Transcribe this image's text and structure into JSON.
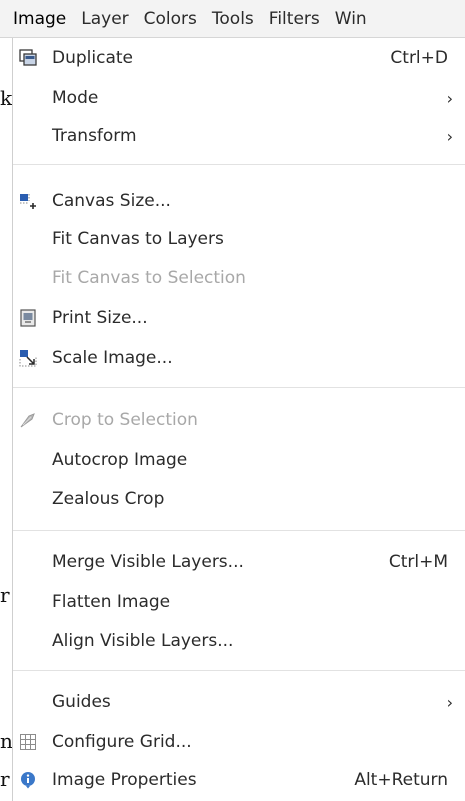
{
  "background": {
    "snippets": [
      "k",
      "r",
      "n",
      "r"
    ]
  },
  "menubar": {
    "items": [
      "Image",
      "Layer",
      "Colors",
      "Tools",
      "Filters",
      "Win"
    ]
  },
  "menu": {
    "duplicate": {
      "label": "Duplicate",
      "accel": "Ctrl+D"
    },
    "mode": {
      "label": "Mode",
      "arrow": "›"
    },
    "transform": {
      "label": "Transform",
      "arrow": "›"
    },
    "canvas_size": {
      "label": "Canvas Size..."
    },
    "fit_canvas_layers": {
      "label": "Fit Canvas to Layers"
    },
    "fit_canvas_selection": {
      "label": "Fit Canvas to Selection"
    },
    "print_size": {
      "label": "Print Size..."
    },
    "scale_image": {
      "label": "Scale Image..."
    },
    "crop_selection": {
      "label": "Crop to Selection"
    },
    "autocrop": {
      "label": "Autocrop Image"
    },
    "zealous_crop": {
      "label": "Zealous Crop"
    },
    "merge_visible": {
      "label": "Merge Visible Layers...",
      "accel": "Ctrl+M"
    },
    "flatten": {
      "label": "Flatten Image"
    },
    "align_visible": {
      "label": "Align Visible Layers..."
    },
    "guides": {
      "label": "Guides",
      "arrow": "›"
    },
    "configure_grid": {
      "label": "Configure Grid..."
    },
    "image_properties": {
      "label": "Image Properties",
      "accel": "Alt+Return"
    }
  }
}
